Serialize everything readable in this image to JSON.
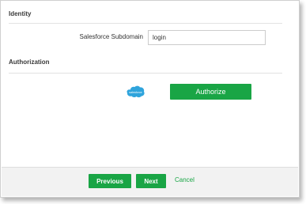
{
  "identity": {
    "title": "Identity",
    "subdomain_label": "Salesforce Subdomain",
    "subdomain_value": "login"
  },
  "authorization": {
    "title": "Authorization",
    "logo_icon": "salesforce-cloud-icon",
    "logo_text": "salesforce",
    "authorize_label": "Authorize"
  },
  "footer": {
    "previous_label": "Previous",
    "next_label": "Next",
    "cancel_label": "Cancel"
  },
  "colors": {
    "accent": "#19a545",
    "salesforce_blue": "#2fa4dc",
    "footer_bg": "#f2f2f2"
  }
}
